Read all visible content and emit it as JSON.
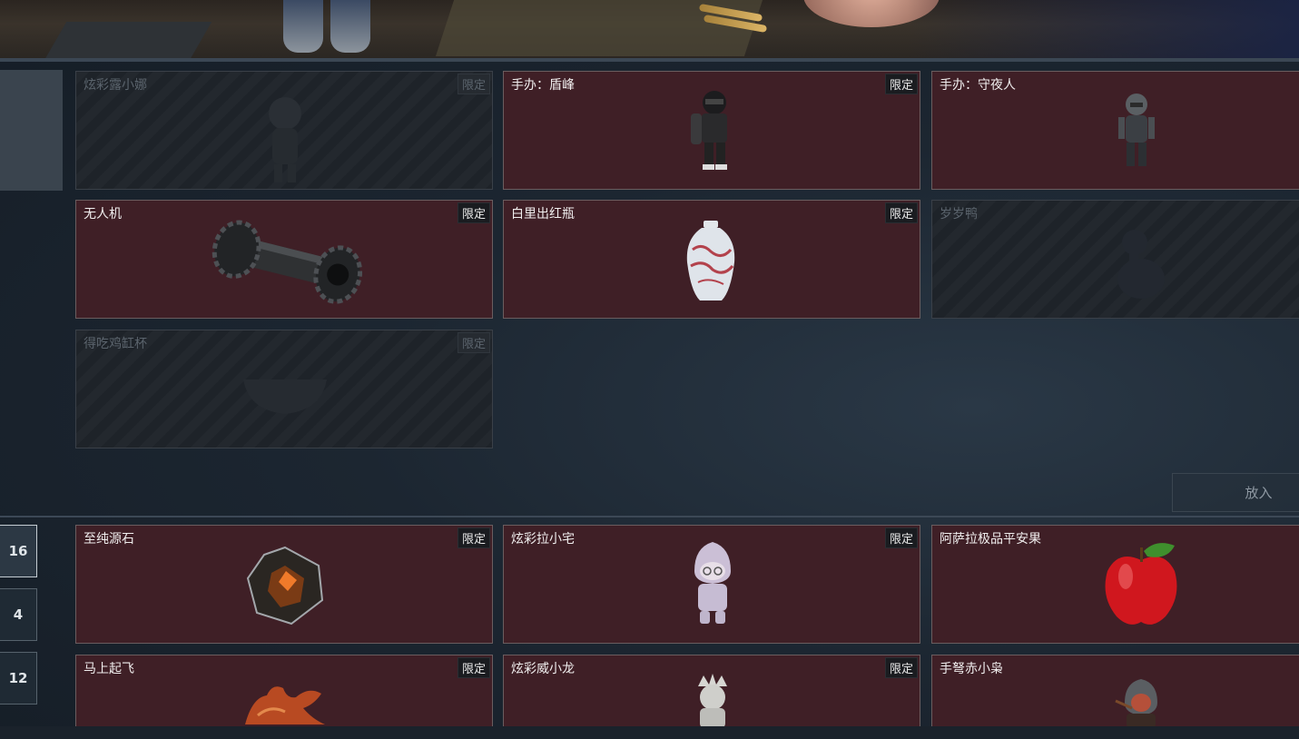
{
  "banner": {
    "label": "scene-banner"
  },
  "badge_text": "限定",
  "place_button": "放入",
  "tabs": [
    "16",
    "4",
    "12"
  ],
  "active_tab": "16",
  "upper_cards": [
    {
      "name": "炫彩露小娜",
      "limited": true,
      "available": false,
      "icon": "doll-figure-icon"
    },
    {
      "name": "手办：盾峰",
      "limited": true,
      "available": true,
      "icon": "armored-figure-icon"
    },
    {
      "name": "手办：守夜人",
      "limited": false,
      "available": true,
      "icon": "soldier-figure-icon"
    },
    {
      "name": "无人机",
      "limited": true,
      "available": true,
      "icon": "drone-cylinder-icon"
    },
    {
      "name": "白里出红瓶",
      "limited": true,
      "available": true,
      "icon": "porcelain-vase-icon"
    },
    {
      "name": "岁岁鸭",
      "limited": false,
      "available": false,
      "icon": "duck-icon"
    },
    {
      "name": "得吃鸡缸杯",
      "limited": true,
      "available": false,
      "icon": "bowl-icon"
    }
  ],
  "lower_cards": [
    {
      "name": "至纯源石",
      "limited": true,
      "available": true,
      "icon": "crystal-gem-icon"
    },
    {
      "name": "炫彩拉小宅",
      "limited": true,
      "available": true,
      "icon": "hooded-doll-icon"
    },
    {
      "name": "阿萨拉极品平安果",
      "limited": false,
      "available": true,
      "icon": "apple-icon"
    },
    {
      "name": "马上起飞",
      "limited": true,
      "available": true,
      "icon": "horse-sculpture-icon"
    },
    {
      "name": "炫彩威小龙",
      "limited": true,
      "available": true,
      "icon": "crowned-doll-icon"
    },
    {
      "name": "手弩赤小枭",
      "limited": false,
      "available": true,
      "icon": "hooded-archer-icon"
    }
  ]
}
